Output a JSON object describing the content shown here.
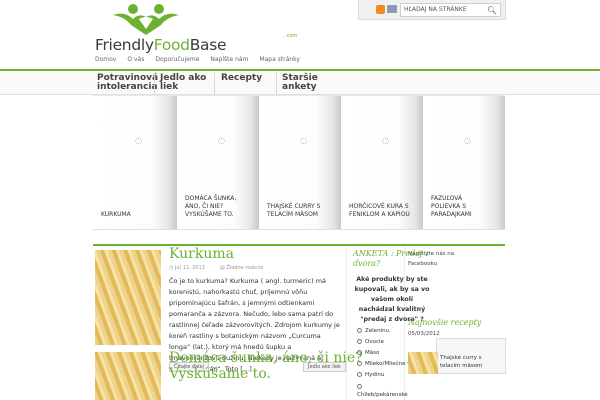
{
  "header": {
    "logo_part1": "Friendly",
    "logo_part2": "Food",
    "logo_part3": "Base",
    "logo_suffix": ".com",
    "search_placeholder": "HĽADAJ NA STRÁNKE",
    "search_icon": "magnifier-icon",
    "rss_icon": "rss-icon",
    "mail_icon": "mail-icon",
    "brand_color": "#6cb22f"
  },
  "topnav": [
    "Domov",
    "O vás",
    "Doporučujeme",
    "Napíšte nám",
    "Mapa stránky"
  ],
  "mainnav": [
    {
      "line1": "Potravinová",
      "line2": "intolerancia"
    },
    {
      "line1": "Jedlo ako",
      "line2": "liek"
    },
    {
      "line1": "Recepty",
      "line2": ""
    },
    {
      "line1": "Staršie",
      "line2": "ankety"
    }
  ],
  "slides": [
    {
      "caption": "KURKUMA"
    },
    {
      "caption": "DOMÁCA ŠUNKA, ÁNO, ČI NIE? VYSKÚŠAME TO."
    },
    {
      "caption": "THAJSKÉ CURRY S TELACÍM MÄSOM"
    },
    {
      "caption": "HORČICOVÉ KURA S FENIKLOM A KAPIOU"
    },
    {
      "caption": "FAZUĽOVÁ POLIEVKA S PARADAJKAMI"
    }
  ],
  "article1": {
    "title": "Kurkuma",
    "date": "Júl 11, 2013",
    "comments": "Žiadne reakcie",
    "excerpt": "Čo je to kurkuma? Kurkuma ( angl. turmeric) má korenistú, nahorkastú chuť, príjemnú vôňu pripomínajúcu šafrán, s jemnými odtienkami pomaranča a zázvora. Nečudo, lebo sama patrí do rastlinnej čeľade zázvorovitých. Zdrojom kurkumy je koreň rastliny s botanickým názvom „Curcuma longa“ (lat.), ktorý má hnedú šupku a tmavooranžovú dužinu. Niekedy je nazývaná aj „Indický šafrán“. Toto […]",
    "read_more": "Čítajte ďalej",
    "category": "Jedlo ako liek"
  },
  "article2": {
    "title_line1": "Domáca šunka, áno, či nie?",
    "title_line2": "Vyskúšame to."
  },
  "poll": {
    "title_line1": "ANKETA : Predaj z",
    "title_line2": "dvora?",
    "question": "Aké produkty by ste kupovali, ak by sa vo vašom okolí nachádzal kvalitný \"predaj z dvora\" ?",
    "options": [
      "Zeleninu",
      "Ovocie",
      "Mäso",
      "Mlieko/Mliečne výrobky",
      "Hydinu",
      "Chlieb/pekárenské výrobky"
    ]
  },
  "sidebar": {
    "facebook_line1": "Navštívte nás na",
    "facebook_line2": "Facebooku",
    "latest_title": "Najnovšie recepty",
    "latest_date": "05/03/2012",
    "latest_item": "Thajské curry s telacím mäsom"
  }
}
